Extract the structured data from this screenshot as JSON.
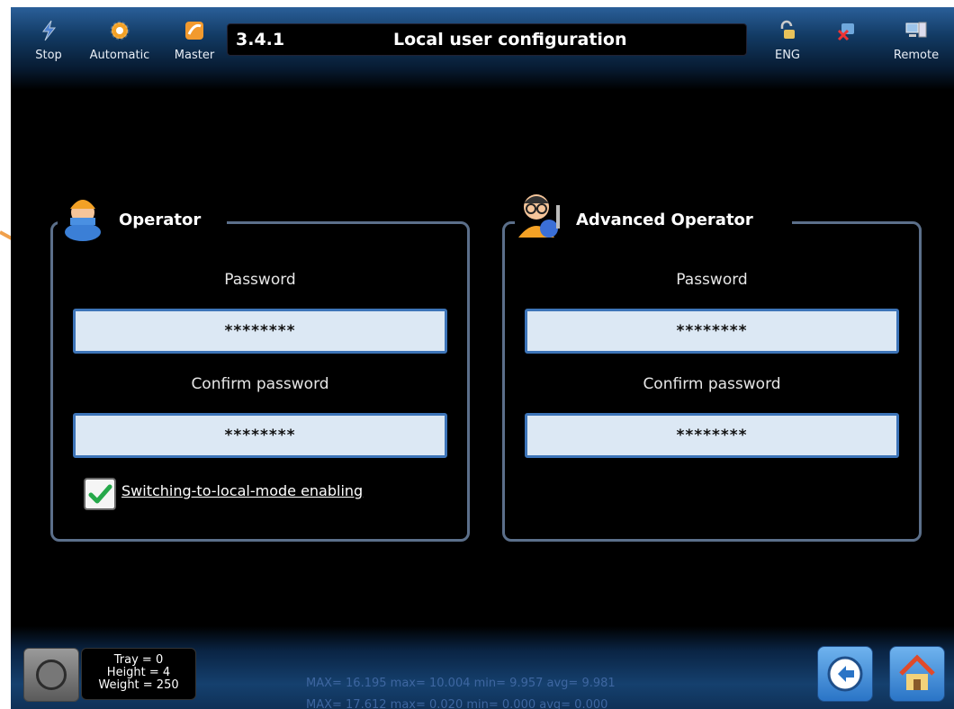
{
  "toolbar": {
    "stop_label": "Stop",
    "automatic_label": "Automatic",
    "master_label": "Master",
    "lang_label": "ENG",
    "remote_label": "Remote"
  },
  "title": {
    "code": "3.4.1",
    "text": "Local user configuration"
  },
  "panels": [
    {
      "title": "Operator",
      "icon": "operator-icon",
      "password_label": "Password",
      "password_value": "********",
      "confirm_label": "Confirm password",
      "confirm_value": "********",
      "checkbox_label": "Switching-to-local-mode enabling",
      "checkbox_checked": true
    },
    {
      "title": "Advanced Operator",
      "icon": "advanced-operator-icon",
      "password_label": "Password",
      "password_value": "********",
      "confirm_label": "Confirm password",
      "confirm_value": "********"
    }
  ],
  "status": {
    "tray": "Tray = 0",
    "height": "Height = 4",
    "weight": "Weight  = 250",
    "stats_line1": "MAX= 16.195 max= 10.004  min= 9.957  avg= 9.981",
    "stats_line2": "MAX= 17.612 max= 0.020  min= 0.000  avg= 0.000"
  },
  "colors": {
    "accent": "#3d74b8",
    "field_bg": "#dce8f4",
    "pointer": "#f0a04b"
  }
}
